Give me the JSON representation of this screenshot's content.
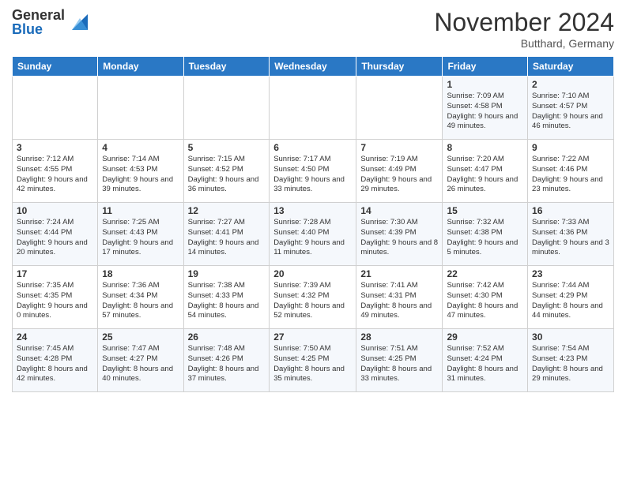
{
  "header": {
    "logo_general": "General",
    "logo_blue": "Blue",
    "month_title": "November 2024",
    "location": "Butthard, Germany"
  },
  "weekdays": [
    "Sunday",
    "Monday",
    "Tuesday",
    "Wednesday",
    "Thursday",
    "Friday",
    "Saturday"
  ],
  "weeks": [
    [
      {
        "day": "",
        "info": ""
      },
      {
        "day": "",
        "info": ""
      },
      {
        "day": "",
        "info": ""
      },
      {
        "day": "",
        "info": ""
      },
      {
        "day": "",
        "info": ""
      },
      {
        "day": "1",
        "info": "Sunrise: 7:09 AM\nSunset: 4:58 PM\nDaylight: 9 hours and 49 minutes."
      },
      {
        "day": "2",
        "info": "Sunrise: 7:10 AM\nSunset: 4:57 PM\nDaylight: 9 hours and 46 minutes."
      }
    ],
    [
      {
        "day": "3",
        "info": "Sunrise: 7:12 AM\nSunset: 4:55 PM\nDaylight: 9 hours and 42 minutes."
      },
      {
        "day": "4",
        "info": "Sunrise: 7:14 AM\nSunset: 4:53 PM\nDaylight: 9 hours and 39 minutes."
      },
      {
        "day": "5",
        "info": "Sunrise: 7:15 AM\nSunset: 4:52 PM\nDaylight: 9 hours and 36 minutes."
      },
      {
        "day": "6",
        "info": "Sunrise: 7:17 AM\nSunset: 4:50 PM\nDaylight: 9 hours and 33 minutes."
      },
      {
        "day": "7",
        "info": "Sunrise: 7:19 AM\nSunset: 4:49 PM\nDaylight: 9 hours and 29 minutes."
      },
      {
        "day": "8",
        "info": "Sunrise: 7:20 AM\nSunset: 4:47 PM\nDaylight: 9 hours and 26 minutes."
      },
      {
        "day": "9",
        "info": "Sunrise: 7:22 AM\nSunset: 4:46 PM\nDaylight: 9 hours and 23 minutes."
      }
    ],
    [
      {
        "day": "10",
        "info": "Sunrise: 7:24 AM\nSunset: 4:44 PM\nDaylight: 9 hours and 20 minutes."
      },
      {
        "day": "11",
        "info": "Sunrise: 7:25 AM\nSunset: 4:43 PM\nDaylight: 9 hours and 17 minutes."
      },
      {
        "day": "12",
        "info": "Sunrise: 7:27 AM\nSunset: 4:41 PM\nDaylight: 9 hours and 14 minutes."
      },
      {
        "day": "13",
        "info": "Sunrise: 7:28 AM\nSunset: 4:40 PM\nDaylight: 9 hours and 11 minutes."
      },
      {
        "day": "14",
        "info": "Sunrise: 7:30 AM\nSunset: 4:39 PM\nDaylight: 9 hours and 8 minutes."
      },
      {
        "day": "15",
        "info": "Sunrise: 7:32 AM\nSunset: 4:38 PM\nDaylight: 9 hours and 5 minutes."
      },
      {
        "day": "16",
        "info": "Sunrise: 7:33 AM\nSunset: 4:36 PM\nDaylight: 9 hours and 3 minutes."
      }
    ],
    [
      {
        "day": "17",
        "info": "Sunrise: 7:35 AM\nSunset: 4:35 PM\nDaylight: 9 hours and 0 minutes."
      },
      {
        "day": "18",
        "info": "Sunrise: 7:36 AM\nSunset: 4:34 PM\nDaylight: 8 hours and 57 minutes."
      },
      {
        "day": "19",
        "info": "Sunrise: 7:38 AM\nSunset: 4:33 PM\nDaylight: 8 hours and 54 minutes."
      },
      {
        "day": "20",
        "info": "Sunrise: 7:39 AM\nSunset: 4:32 PM\nDaylight: 8 hours and 52 minutes."
      },
      {
        "day": "21",
        "info": "Sunrise: 7:41 AM\nSunset: 4:31 PM\nDaylight: 8 hours and 49 minutes."
      },
      {
        "day": "22",
        "info": "Sunrise: 7:42 AM\nSunset: 4:30 PM\nDaylight: 8 hours and 47 minutes."
      },
      {
        "day": "23",
        "info": "Sunrise: 7:44 AM\nSunset: 4:29 PM\nDaylight: 8 hours and 44 minutes."
      }
    ],
    [
      {
        "day": "24",
        "info": "Sunrise: 7:45 AM\nSunset: 4:28 PM\nDaylight: 8 hours and 42 minutes."
      },
      {
        "day": "25",
        "info": "Sunrise: 7:47 AM\nSunset: 4:27 PM\nDaylight: 8 hours and 40 minutes."
      },
      {
        "day": "26",
        "info": "Sunrise: 7:48 AM\nSunset: 4:26 PM\nDaylight: 8 hours and 37 minutes."
      },
      {
        "day": "27",
        "info": "Sunrise: 7:50 AM\nSunset: 4:25 PM\nDaylight: 8 hours and 35 minutes."
      },
      {
        "day": "28",
        "info": "Sunrise: 7:51 AM\nSunset: 4:25 PM\nDaylight: 8 hours and 33 minutes."
      },
      {
        "day": "29",
        "info": "Sunrise: 7:52 AM\nSunset: 4:24 PM\nDaylight: 8 hours and 31 minutes."
      },
      {
        "day": "30",
        "info": "Sunrise: 7:54 AM\nSunset: 4:23 PM\nDaylight: 8 hours and 29 minutes."
      }
    ]
  ]
}
